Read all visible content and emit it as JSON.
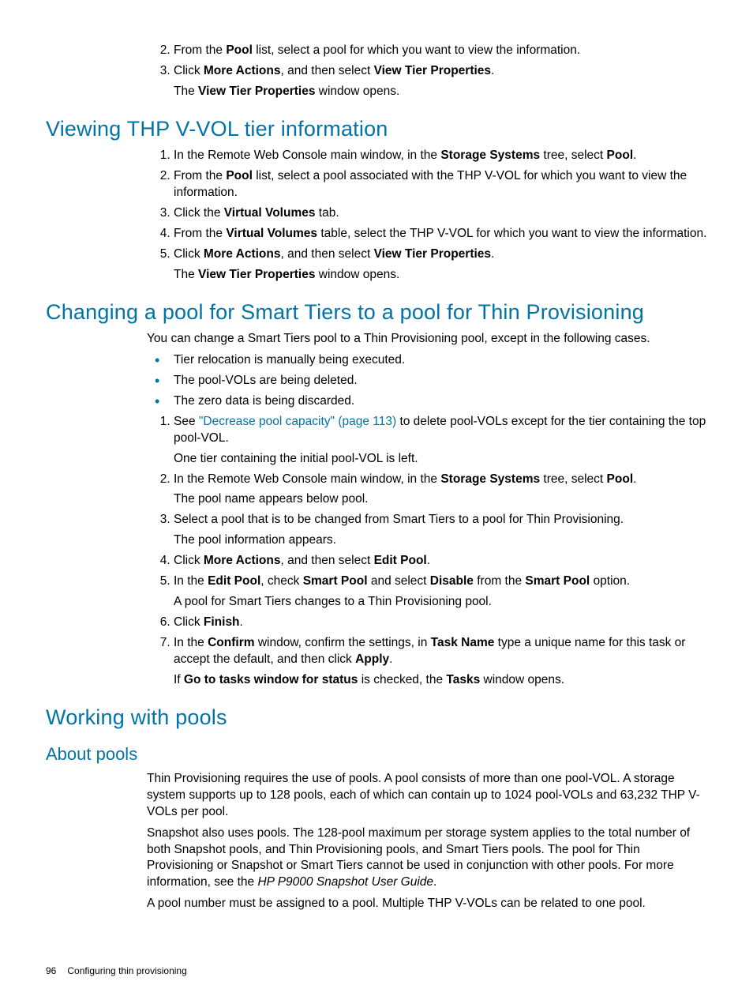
{
  "top_steps": [
    {
      "pre": "From the ",
      "b1": "Pool",
      "mid": " list, select a pool for which you want to view the information.",
      "rest": ""
    },
    {
      "pre": "Click ",
      "b1": "More Actions",
      "mid": ", and then select ",
      "b2": "View Tier Properties",
      "suffix": ".",
      "note_pre": "The ",
      "note_b": "View Tier Properties",
      "note_post": " window opens."
    }
  ],
  "h_vvol": "Viewing THP V-VOL tier information",
  "vvol_steps": [
    {
      "pre": "In the Remote Web Console main window, in the ",
      "b1": "Storage Systems",
      "mid": " tree, select ",
      "b2": "Pool",
      "suffix": "."
    },
    {
      "pre": "From the ",
      "b1": "Pool",
      "mid": " list, select a pool associated with the THP V-VOL for which you want to view the information."
    },
    {
      "pre": "Click the ",
      "b1": "Virtual Volumes",
      "mid": " tab."
    },
    {
      "pre": "From the ",
      "b1": "Virtual Volumes",
      "mid": " table, select the THP V-VOL for which you want to view the information."
    },
    {
      "pre": "Click ",
      "b1": "More Actions",
      "mid": ", and then select ",
      "b2": "View Tier Properties",
      "suffix": ".",
      "note_pre": "The ",
      "note_b": "View Tier Properties",
      "note_post": " window opens."
    }
  ],
  "h_change": "Changing a pool for Smart Tiers to a pool for Thin Provisioning",
  "change_intro": "You can change a Smart Tiers pool to a Thin Provisioning pool, except in the following cases.",
  "change_bullets": [
    "Tier relocation is manually being executed.",
    "The pool-VOLs are being deleted.",
    "The zero data is being discarded."
  ],
  "change_steps": {
    "s1_pre": "See ",
    "s1_link": "\"Decrease pool capacity\" (page 113)",
    "s1_post": " to delete pool-VOLs except for the tier containing the top pool-VOL.",
    "s1_note": "One tier containing the initial pool-VOL is left.",
    "s2_pre": "In the Remote Web Console main window, in the ",
    "s2_b1": "Storage Systems",
    "s2_mid": " tree, select ",
    "s2_b2": "Pool",
    "s2_suffix": ".",
    "s2_note": "The pool name appears below pool.",
    "s3": "Select a pool that is to be changed from Smart Tiers to a pool for Thin Provisioning.",
    "s3_note": "The pool information appears.",
    "s4_pre": "Click ",
    "s4_b1": "More Actions",
    "s4_mid": ", and then select ",
    "s4_b2": "Edit Pool",
    "s4_suffix": ".",
    "s5_pre": "In the ",
    "s5_b1": "Edit Pool",
    "s5_mid1": ", check ",
    "s5_b2": "Smart Pool",
    "s5_mid2": " and select ",
    "s5_b3": "Disable",
    "s5_mid3": " from the ",
    "s5_b4": "Smart Pool",
    "s5_suffix": " option.",
    "s5_note": "A pool for Smart Tiers changes to a Thin Provisioning pool.",
    "s6_pre": "Click ",
    "s6_b1": "Finish",
    "s6_suffix": ".",
    "s7_pre": "In the ",
    "s7_b1": "Confirm",
    "s7_mid1": " window, confirm the settings, in ",
    "s7_b2": "Task Name",
    "s7_mid2": " type a unique name for this task or accept the default, and then click ",
    "s7_b3": "Apply",
    "s7_suffix": ".",
    "s7_note_pre": "If ",
    "s7_note_b1": "Go to tasks window for status",
    "s7_note_mid": " is checked, the ",
    "s7_note_b2": "Tasks",
    "s7_note_post": " window opens."
  },
  "h_working": "Working with pools",
  "h_about": "About pools",
  "about_p1": "Thin Provisioning requires the use of pools. A pool consists of more than one pool-VOL. A storage system supports up to 128 pools, each of which can contain up to 1024 pool-VOLs and 63,232 THP V-VOLs per pool.",
  "about_p2_pre": "Snapshot also uses pools. The 128-pool maximum per storage system applies to the total number of both Snapshot pools, and Thin Provisioning pools, and Smart Tiers pools. The pool for Thin Provisioning or Snapshot or Smart Tiers cannot be used in conjunction with other pools. For more information, see the ",
  "about_p2_i": "HP P9000 Snapshot User Guide",
  "about_p2_post": ".",
  "about_p3": "A pool number must be assigned to a pool. Multiple THP V-VOLs can be related to one pool.",
  "footer_page": "96",
  "footer_title": "Configuring thin provisioning"
}
